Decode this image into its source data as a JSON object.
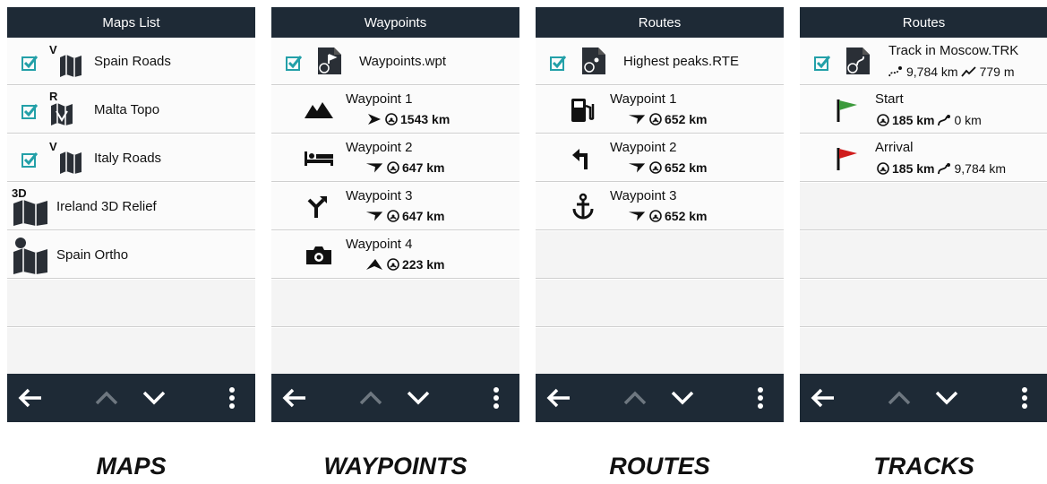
{
  "colors": {
    "bar": "#1e2a36",
    "accent": "#23a0a8",
    "flag_start": "#3c9a3c",
    "flag_end": "#d01c1c"
  },
  "maps": {
    "title": "Maps List",
    "caption": "MAPS",
    "items": [
      {
        "label": "Spain Roads",
        "badge": "V",
        "checked": true
      },
      {
        "label": "Malta Topo",
        "badge": "R",
        "checked": true
      },
      {
        "label": "Italy Roads",
        "badge": "V",
        "checked": true
      },
      {
        "label": "Ireland 3D Relief",
        "badge": "3D",
        "checked": false
      },
      {
        "label": "Spain Ortho",
        "badge": "",
        "checked": false
      }
    ]
  },
  "waypoints": {
    "title": "Waypoints",
    "caption": "WAYPOINTS",
    "file": "Waypoints.wpt",
    "items": [
      {
        "name": "Waypoint 1",
        "distance": "1543 km",
        "icon": "mountain-icon"
      },
      {
        "name": "Waypoint 2",
        "distance": "647 km",
        "icon": "bed-icon"
      },
      {
        "name": "Waypoint 3",
        "distance": "647 km",
        "icon": "turn-icon"
      },
      {
        "name": "Waypoint 4",
        "distance": "223 km",
        "icon": "camera-icon"
      }
    ]
  },
  "routes": {
    "title": "Routes",
    "caption": "ROUTES",
    "file": "Highest peaks.RTE",
    "items": [
      {
        "name": "Waypoint 1",
        "distance": "652 km",
        "icon": "fuel-icon"
      },
      {
        "name": "Waypoint 2",
        "distance": "652 km",
        "icon": "turn-left-icon"
      },
      {
        "name": "Waypoint 3",
        "distance": "652 km",
        "icon": "anchor-icon"
      }
    ]
  },
  "tracks": {
    "title": "Routes",
    "caption": "TRACKS",
    "file": "Track in Moscow.TRK",
    "length": "9,784 km",
    "elevation": "779 m",
    "items": [
      {
        "name": "Start",
        "distance": "185 km",
        "track_distance": "0 km"
      },
      {
        "name": "Arrival",
        "distance": "185 km",
        "track_distance": "9,784 km"
      }
    ]
  }
}
